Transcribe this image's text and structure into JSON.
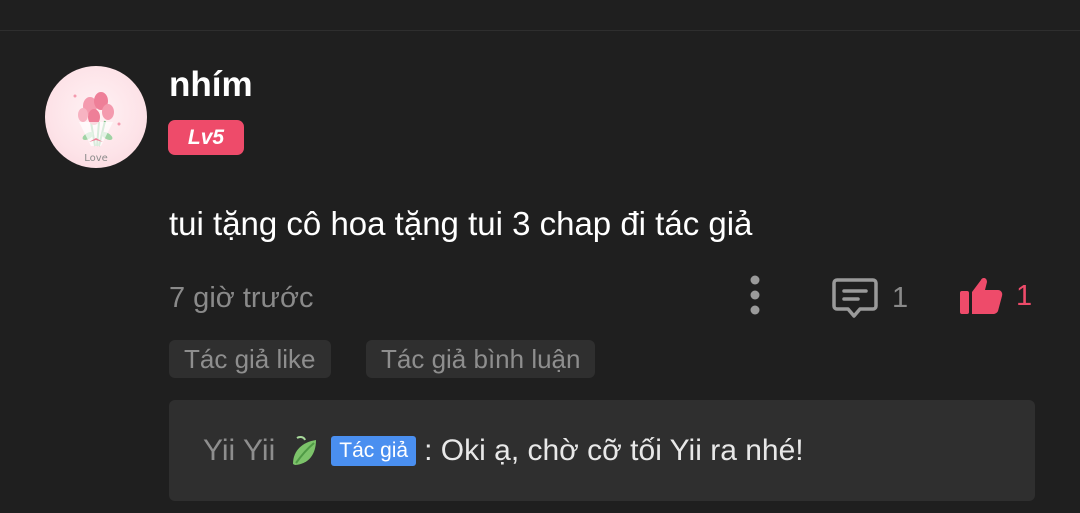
{
  "comment": {
    "username": "nhím",
    "level": "Lv5",
    "text": "tui tặng cô hoa tặng tui 3 chap đi tác giả",
    "timestamp": "7 giờ trước",
    "reply_count": "1",
    "like_count": "1",
    "avatar_caption": "Love"
  },
  "tags": [
    {
      "label": "Tác giả like"
    },
    {
      "label": "Tác giả bình luận"
    }
  ],
  "reply": {
    "author": "Yii Yii",
    "badge": "Tác giả",
    "text": ": Oki ạ, chờ cỡ tối Yii ra nhé!"
  },
  "colors": {
    "background": "#1f1f1f",
    "accent_pink": "#ee4b6a",
    "badge_blue": "#4a8ff0",
    "muted_text": "#8a8a8a",
    "panel": "#2f2f2f"
  },
  "icons": {
    "more": "vertical-dots-icon",
    "reply": "comment-bubble-icon",
    "like": "thumbs-up-icon",
    "leaf": "leaf-icon"
  }
}
